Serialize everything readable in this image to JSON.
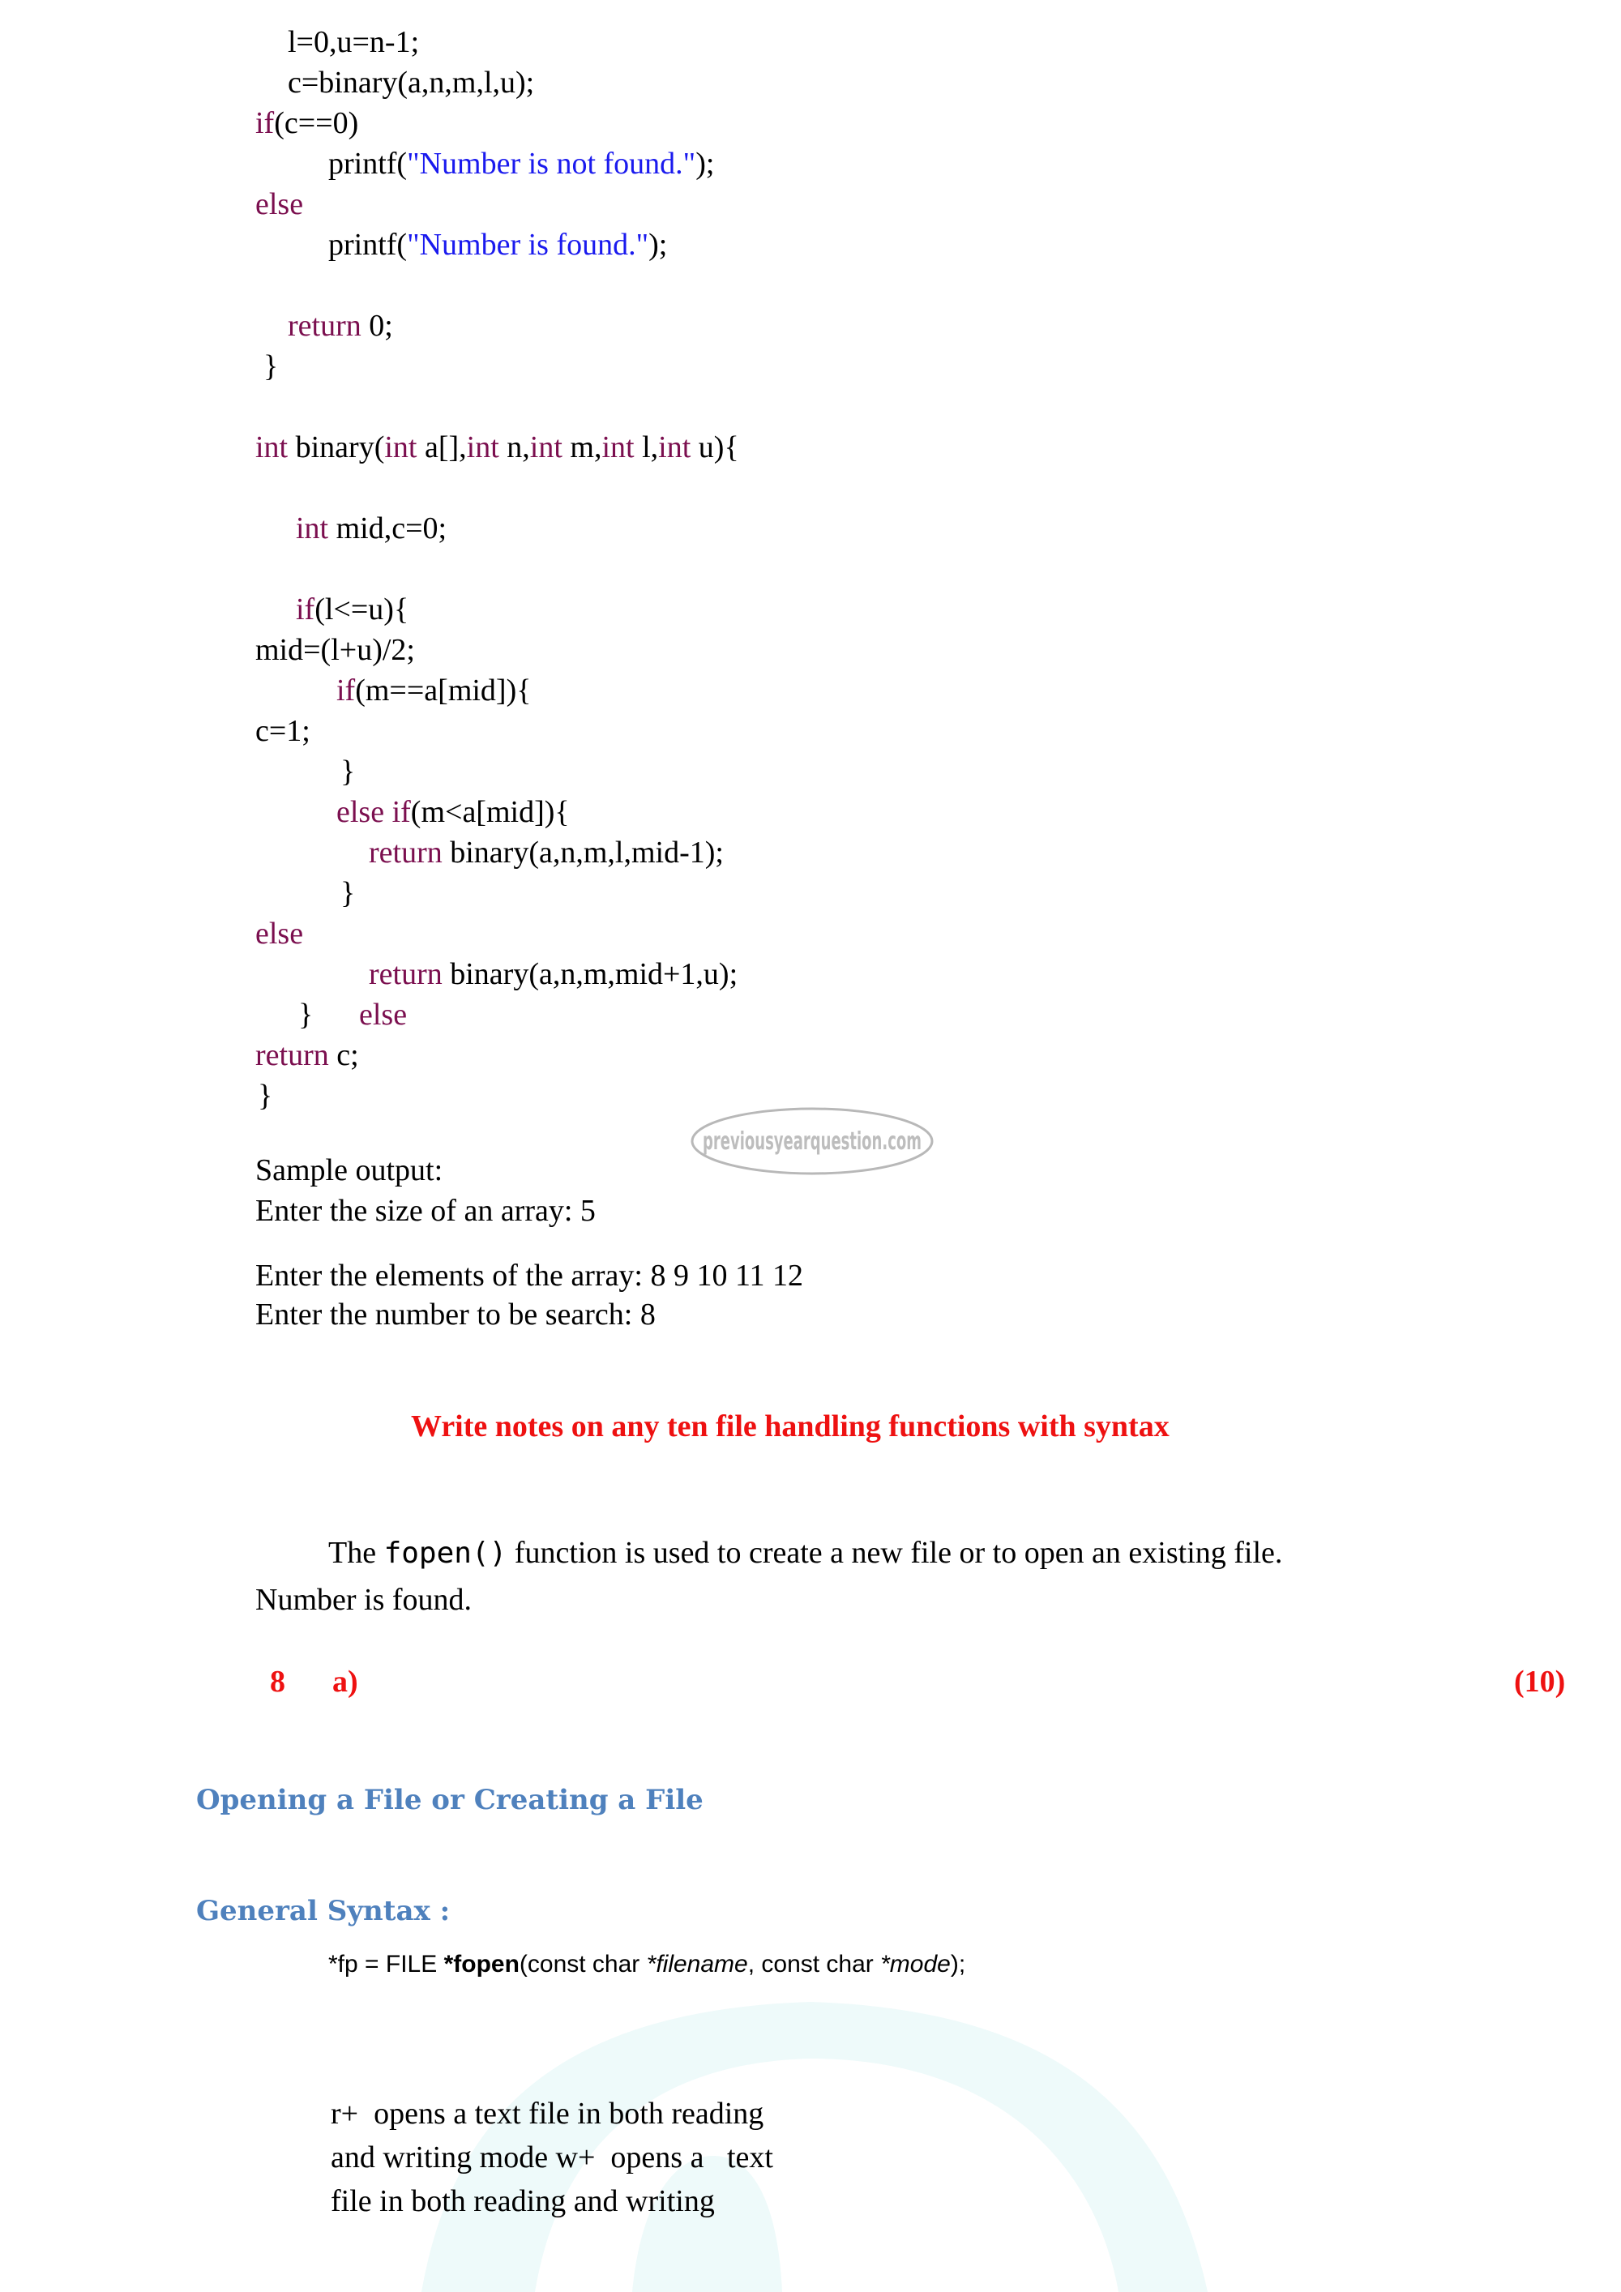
{
  "code": {
    "main_tail": {
      "line1": "l=0,u=n-1;",
      "line2": "c=binary(a,n,m,l,u);",
      "if_kw": "if",
      "if_cond": "(c==0)",
      "printf1_fn": "printf(",
      "printf1_str": "\"Number is not found.\"",
      "printf1_end": ");",
      "else_kw": "else",
      "printf2_fn": "printf(",
      "printf2_str": "\"Number is found.\"",
      "printf2_end": ");",
      "return_kw": "return",
      "return_val": " 0;",
      "close_brace": "}"
    },
    "binary_fn": {
      "sig_int1": "int",
      "sig_name": " binary(",
      "sig_int2": "int",
      "sig_a": " a[],",
      "sig_int3": "int",
      "sig_n": " n,",
      "sig_int4": "int",
      "sig_m": " m,",
      "sig_int5": "int",
      "sig_l": " l,",
      "sig_int6": "int",
      "sig_u": " u){",
      "decl_kw": "int",
      "decl_rest": " mid,c=0;",
      "if1_kw": "if",
      "if1_rest": "(l<=u){",
      "mid_calc": "mid=(l+u)/2;",
      "if2_kw": "if",
      "if2_rest": "(m==a[mid]){",
      "c_assign": "c=1;",
      "brace1": "}",
      "elseif_kw": "else if",
      "elseif_rest": "(m<a[mid]){",
      "ret1_kw": "return",
      "ret1_rest": " binary(a,n,m,l,mid-1);",
      "brace2": "}",
      "else1_kw": "else",
      "ret2_kw": "return",
      "ret2_rest": " binary(a,n,m,mid+1,u);",
      "brace3": "}",
      "else2_kw": "else",
      "ret3_kw": "return",
      "ret3_rest": " c;",
      "brace4": "}"
    }
  },
  "sample_output": {
    "heading": "Sample output:",
    "line1": "Enter the size of an array: 5",
    "line2": "Enter the elements of the array: 8 9 10 11 12",
    "line3": "Enter the number to be search: 8"
  },
  "watermark": {
    "logo_text": "previousyearquestion.com"
  },
  "question": {
    "title": "Write notes on any ten file handling functions with syntax",
    "number": "8",
    "part": "a)",
    "marks": "(10)"
  },
  "body": {
    "fopen_pre": "The ",
    "fopen_code": "fopen()",
    "fopen_post": " function is used to create a new file or to open an existing file.",
    "number_found": "Number is found."
  },
  "section": {
    "heading1": "Opening a File or Creating a File",
    "heading2": "General Syntax :",
    "syntax_pre": "*fp = FILE ",
    "syntax_bold": "*fopen",
    "syntax_mid1": "(const char ",
    "syntax_it1": "*filename",
    "syntax_mid2": ", const char ",
    "syntax_it2": "*mode",
    "syntax_end": ");"
  },
  "modes": {
    "line1": "r+  opens a text file in both reading",
    "line2": "and writing mode w+  opens a   text",
    "line3": "file in both reading and writing"
  },
  "colors": {
    "keyword": "#7b0f4f",
    "string": "#1a1aee",
    "question_red": "#ee1111",
    "heading_blue": "#4f81bd",
    "watermark_tint": "#eefafa"
  }
}
